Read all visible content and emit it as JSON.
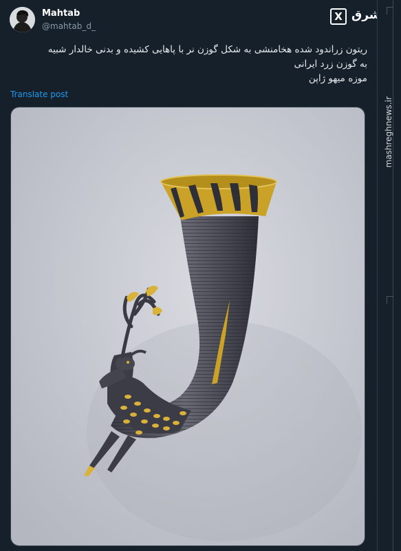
{
  "author": {
    "name": "Mahtab",
    "handle": "@mahtab_d_"
  },
  "tweet": {
    "lines": [
      "ریتون زراندود شده هخامنشی به شکل گوزن نر با پاهایی کشیده و بدنی خالدار شبیه",
      "به گوزن زرد ایرانی",
      "موزه میهو ژاپن"
    ],
    "translate_label": "Translate post"
  },
  "branding": {
    "x_logo": "X",
    "site_logo": "مشرق",
    "watermark": "mashreghnews.ir"
  },
  "media": {
    "alt": "Achaemenid gilded rhyton with stag protome"
  },
  "icons": [
    "x-logo-icon",
    "mashregh-logo-icon"
  ],
  "colors": {
    "background": "#15202b",
    "link": "#1d9bf0",
    "secondary_text": "#8b98a5",
    "photo_background": "#c9cbd3",
    "gold": "#c9a227",
    "bronze": "#4a4a52"
  }
}
